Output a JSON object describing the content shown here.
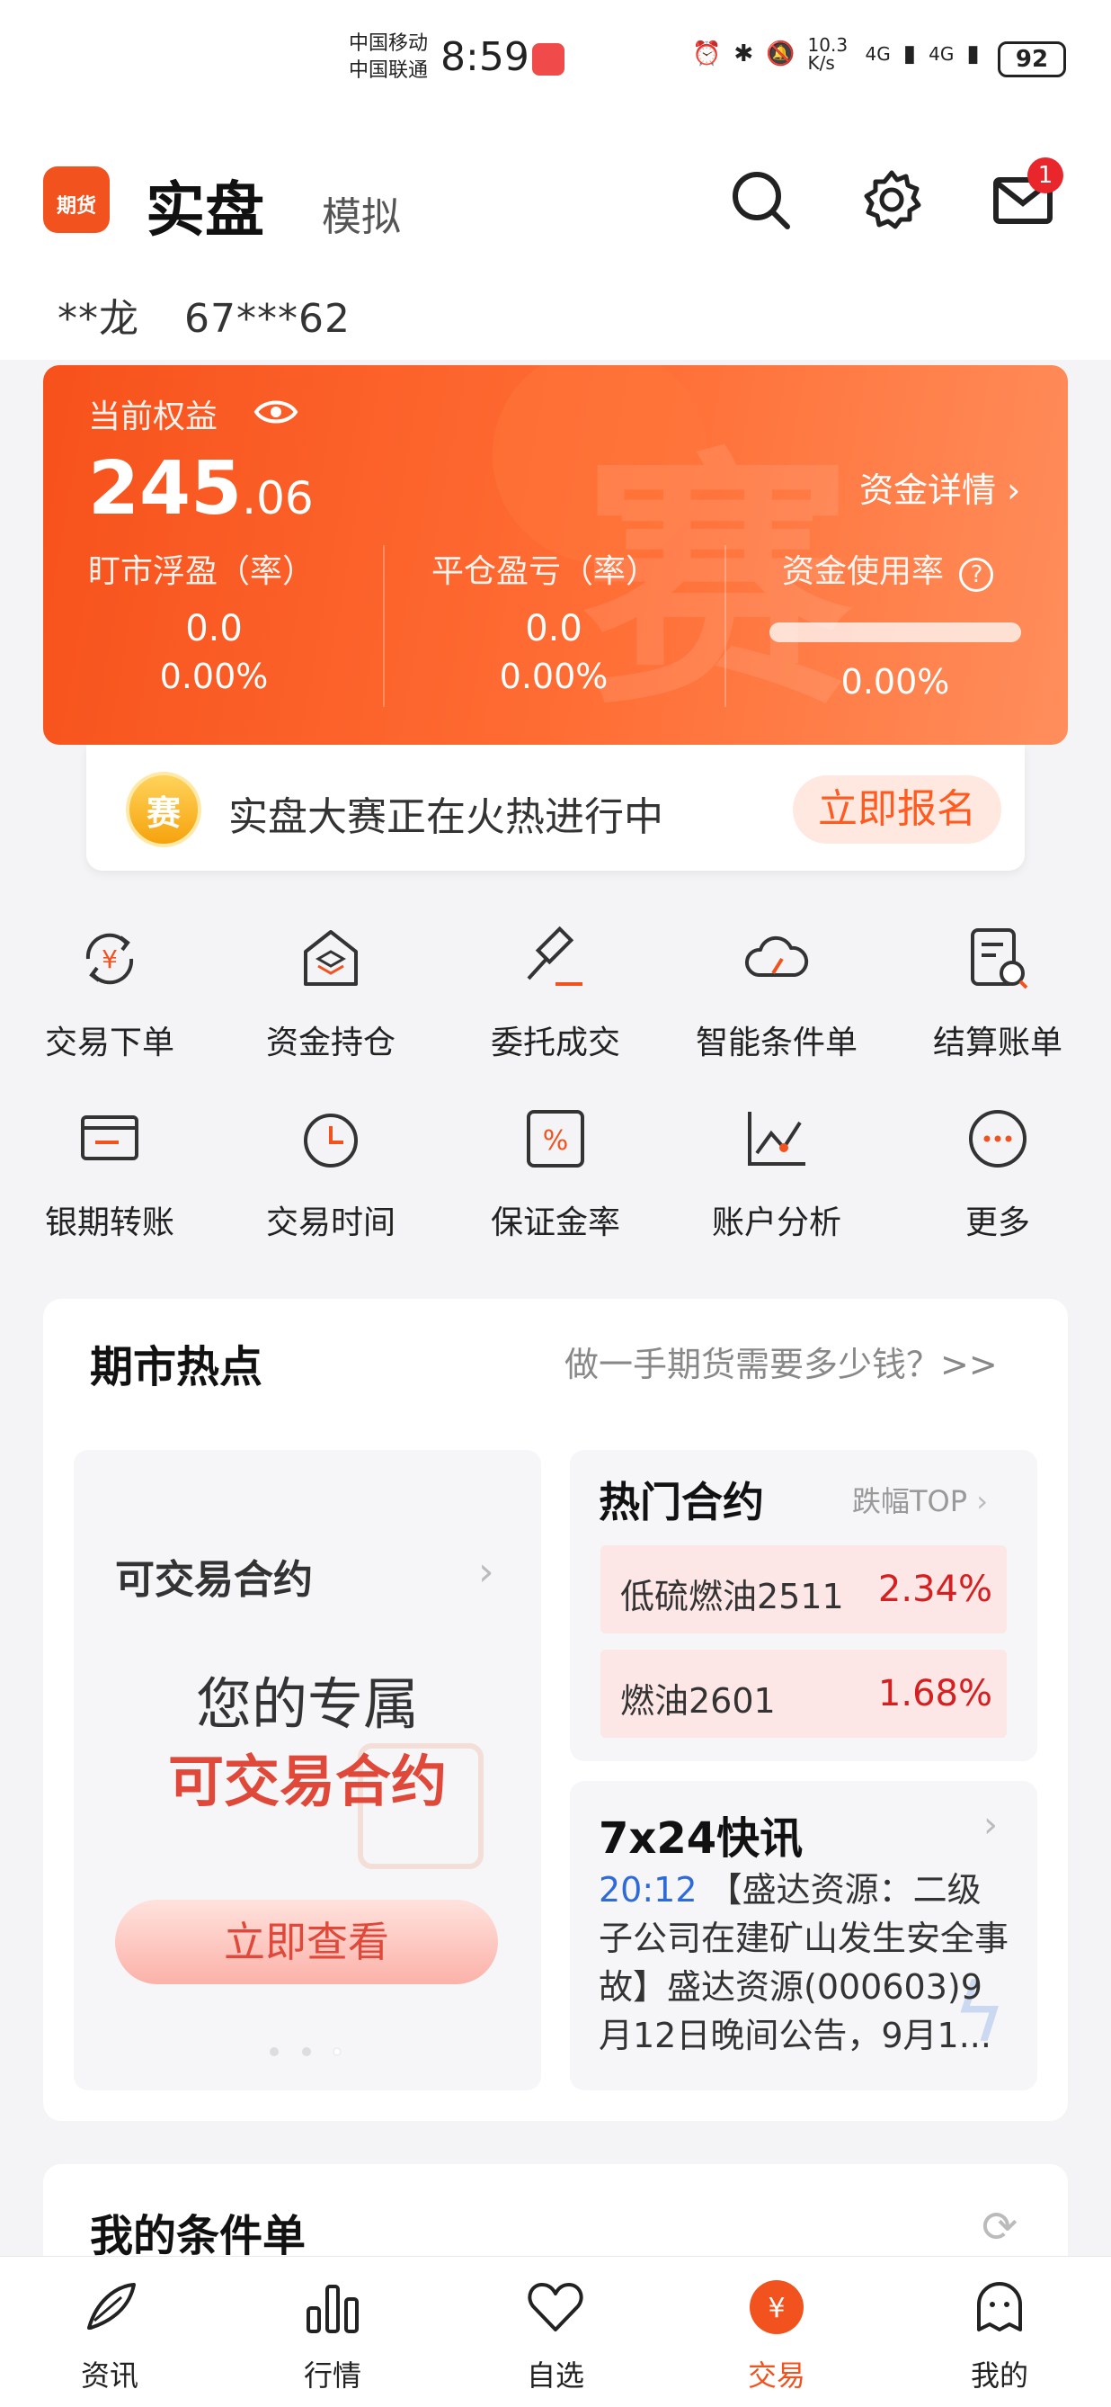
{
  "status_bar": {
    "carrier1": "中国移动",
    "carrier2": "中国联通",
    "time": "8:59",
    "net_speed": "10.3 K/s",
    "network1": "4G",
    "network2": "4G",
    "battery": "92"
  },
  "header": {
    "logo_text": "期货",
    "tab_real": "实盘",
    "tab_sim": "模拟",
    "mail_badge": "1"
  },
  "account": {
    "name": "**龙",
    "id": "67***62"
  },
  "equity_card": {
    "label": "当前权益",
    "value_int": "245",
    "value_dec": ".06",
    "fund_detail": "资金详情",
    "metrics": [
      {
        "label": "盯市浮盈（率）",
        "value": "0.0",
        "rate": "0.00%"
      },
      {
        "label": "平仓盈亏（率）",
        "value": "0.0",
        "rate": "0.00%"
      },
      {
        "label": "资金使用率",
        "rate": "0.00%"
      }
    ],
    "deco_char": "赛",
    "usage_fraction": 0.0
  },
  "contest": {
    "icon_text": "赛",
    "text": "实盘大赛正在火热进行中",
    "button": "立即报名"
  },
  "grid": [
    {
      "label": "交易下单",
      "icon": "yuan-exchange-icon"
    },
    {
      "label": "资金持仓",
      "icon": "house-stack-icon"
    },
    {
      "label": "委托成交",
      "icon": "gavel-icon"
    },
    {
      "label": "智能条件单",
      "icon": "cloud-icon"
    },
    {
      "label": "结算账单",
      "icon": "bill-search-icon"
    },
    {
      "label": "银期转账",
      "icon": "card-transfer-icon"
    },
    {
      "label": "交易时间",
      "icon": "clock-icon"
    },
    {
      "label": "保证金率",
      "icon": "percent-icon"
    },
    {
      "label": "账户分析",
      "icon": "line-chart-icon"
    },
    {
      "label": "更多",
      "icon": "more-dots-icon"
    }
  ],
  "hot": {
    "title": "期市热点",
    "link": "做一手期货需要多少钱？>>",
    "left_panel": {
      "title": "可交易合约",
      "line1": "您的专属",
      "line2": "可交易合约",
      "button": "立即查看"
    },
    "hot_contracts": {
      "title": "热门合约",
      "link": "跌幅TOP",
      "rows": [
        {
          "name": "低硫燃油2511",
          "pct": "2.34%"
        },
        {
          "name": "燃油2601",
          "pct": "1.68%"
        }
      ]
    },
    "news": {
      "title": "7x24快讯",
      "time": "20:12",
      "text": "【盛达资源：二级子公司在建矿山发生安全事故】盛达资源(000603)9月12日晚间公告，9月1..."
    }
  },
  "conditions": {
    "title": "我的条件单"
  },
  "bottom_nav": [
    {
      "label": "资讯",
      "icon": "feather-icon"
    },
    {
      "label": "行情",
      "icon": "bar-chart-icon"
    },
    {
      "label": "自选",
      "icon": "heart-icon"
    },
    {
      "label": "交易",
      "icon": "yuan-circle-icon"
    },
    {
      "label": "我的",
      "icon": "profile-face-icon"
    }
  ],
  "colors": {
    "accent": "#f2521e",
    "loss_red": "#d42020",
    "news_blue": "#2f6bd8"
  }
}
